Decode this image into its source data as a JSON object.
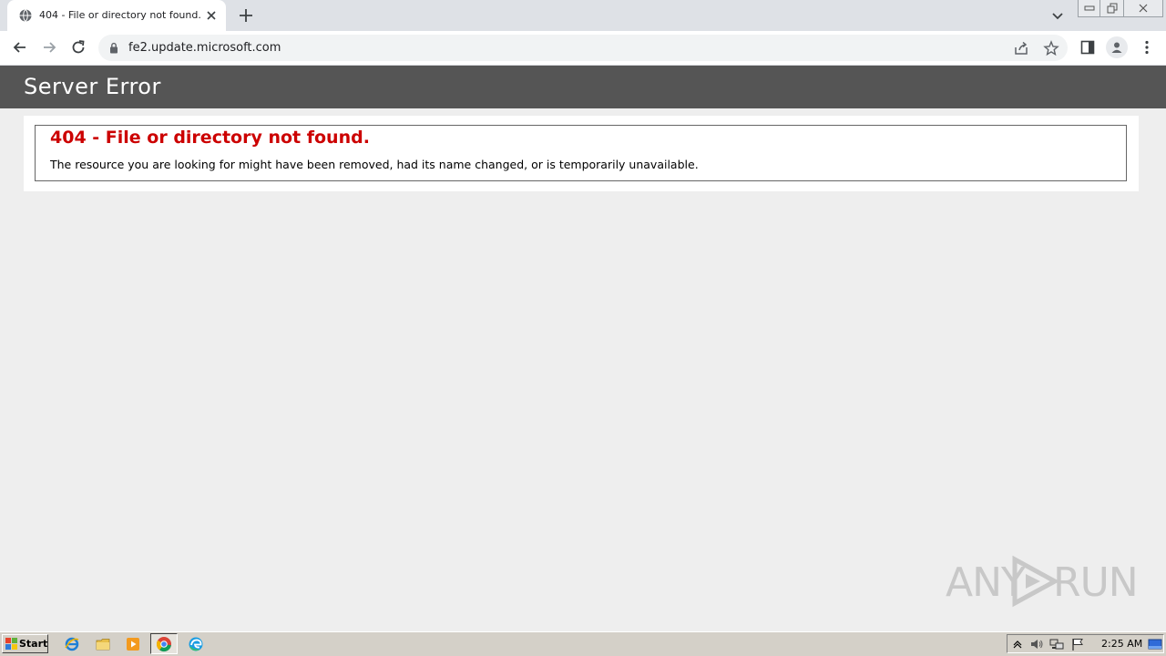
{
  "browser": {
    "tab": {
      "title": "404 - File or directory not found.",
      "favicon": "globe-icon",
      "close_icon": "close-icon"
    },
    "new_tab_icon": "plus-icon",
    "tab_search_icon": "chevron-down-icon",
    "window_controls": [
      "minimize-icon",
      "restore-icon",
      "close-icon"
    ],
    "nav": {
      "back_icon": "arrow-left-icon",
      "forward_icon": "arrow-right-icon",
      "reload_icon": "reload-icon"
    },
    "address_bar": {
      "url": "fe2.update.microsoft.com",
      "lock_icon": "lock-icon",
      "share_icon": "share-icon",
      "bookmark_icon": "star-icon"
    },
    "toolbar_icons": [
      "side-panel-icon",
      "profile-icon",
      "kebab-menu-icon"
    ]
  },
  "page": {
    "header_title": "Server Error",
    "error": {
      "title": "404 - File or directory not found.",
      "description": "The resource you are looking for might have been removed, had its name changed, or is temporarily unavailable."
    },
    "colors": {
      "header_bg": "#555555",
      "error_title": "#cc0000",
      "page_bg": "#eeeeee"
    }
  },
  "watermark": {
    "left": "ANY",
    "right": "RUN"
  },
  "taskbar": {
    "start_label": "Start",
    "pinned": [
      "internet-explorer-icon",
      "file-explorer-icon",
      "media-player-icon",
      "chrome-icon",
      "edge-icon"
    ],
    "active": "chrome-icon",
    "tray_icons": [
      "tray-expand-icon",
      "volume-icon",
      "network-icon",
      "action-center-flag-icon"
    ],
    "clock": "2:25 AM",
    "show_desktop_icon": "show-desktop-icon"
  }
}
